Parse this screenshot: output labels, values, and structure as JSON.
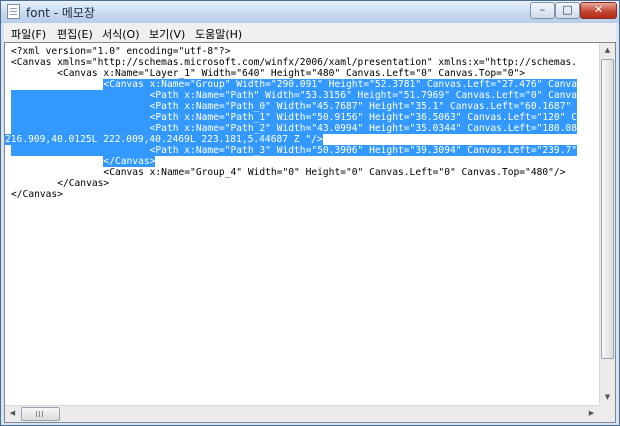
{
  "window": {
    "title": "font - 메모장"
  },
  "window_controls": {
    "minimize": "–",
    "maximize": "□",
    "close": "✕"
  },
  "menu": [
    "파일(F)",
    "편집(E)",
    "서식(O)",
    "보기(V)",
    "도움말(H)"
  ],
  "editor": {
    "lines": [
      {
        "text": "<?xml version=\"1.0\" encoding=\"utf-8\"?>"
      },
      {
        "text": "<Canvas xmlns=\"http://schemas.microsoft.com/winfx/2006/xaml/presentation\" xmlns:x=\"http://schemas."
      },
      {
        "text": "        <Canvas x:Name=\"Layer_1\" Width=\"640\" Height=\"480\" Canvas.Left=\"0\" Canvas.Top=\"0\">"
      },
      {
        "pre": "                ",
        "sel": "<Canvas x:Name=\"Group\" Width=\"290.091\" Height=\"52.3781\" Canvas.Left=\"27.476\" Canva"
      },
      {
        "sel": "                        <Path x:Name=\"Path\" Width=\"53.3156\" Height=\"51.7969\" Canvas.Left=\"0\" Canva"
      },
      {
        "sel": "                        <Path x:Name=\"Path_0\" Width=\"45.7687\" Height=\"35.1\" Canvas.Left=\"60.1687\" "
      },
      {
        "sel": "                        <Path x:Name=\"Path_1\" Width=\"50.9156\" Height=\"36.5063\" Canvas.Left=\"120\" C"
      },
      {
        "sel": "                        <Path x:Name=\"Path_2\" Width=\"43.0994\" Height=\"35.0344\" Canvas.Left=\"180.08"
      },
      {
        "sel": "216.909,40.0125L 222.009,40.2469L 223.181,5.44687 Z \"/>"
      },
      {
        "sel": "                        <Path x:Name=\"Path_3\" Width=\"50.3906\" Height=\"39.3094\" Canvas.Left=\"239.7\""
      },
      {
        "pre": "                ",
        "sel": "</Canvas>"
      },
      {
        "text": "                <Canvas x:Name=\"Group_4\" Width=\"0\" Height=\"0\" Canvas.Left=\"0\" Canvas.Top=\"480\"/>"
      },
      {
        "text": "        </Canvas>"
      },
      {
        "text": "</Canvas>"
      }
    ]
  },
  "colors": {
    "selection": "#3399ff",
    "title_bar": "#c6d8ee",
    "close_button": "#c4452f"
  },
  "icons": {
    "app": "notepad-icon",
    "scroll_left": "arrow-left-icon",
    "scroll_right": "arrow-right-icon",
    "scroll_up": "arrow-up-icon",
    "scroll_down": "arrow-down-icon"
  },
  "glyphs": {
    "left": "◀",
    "right": "▶",
    "up": "▲",
    "down": "▼"
  }
}
